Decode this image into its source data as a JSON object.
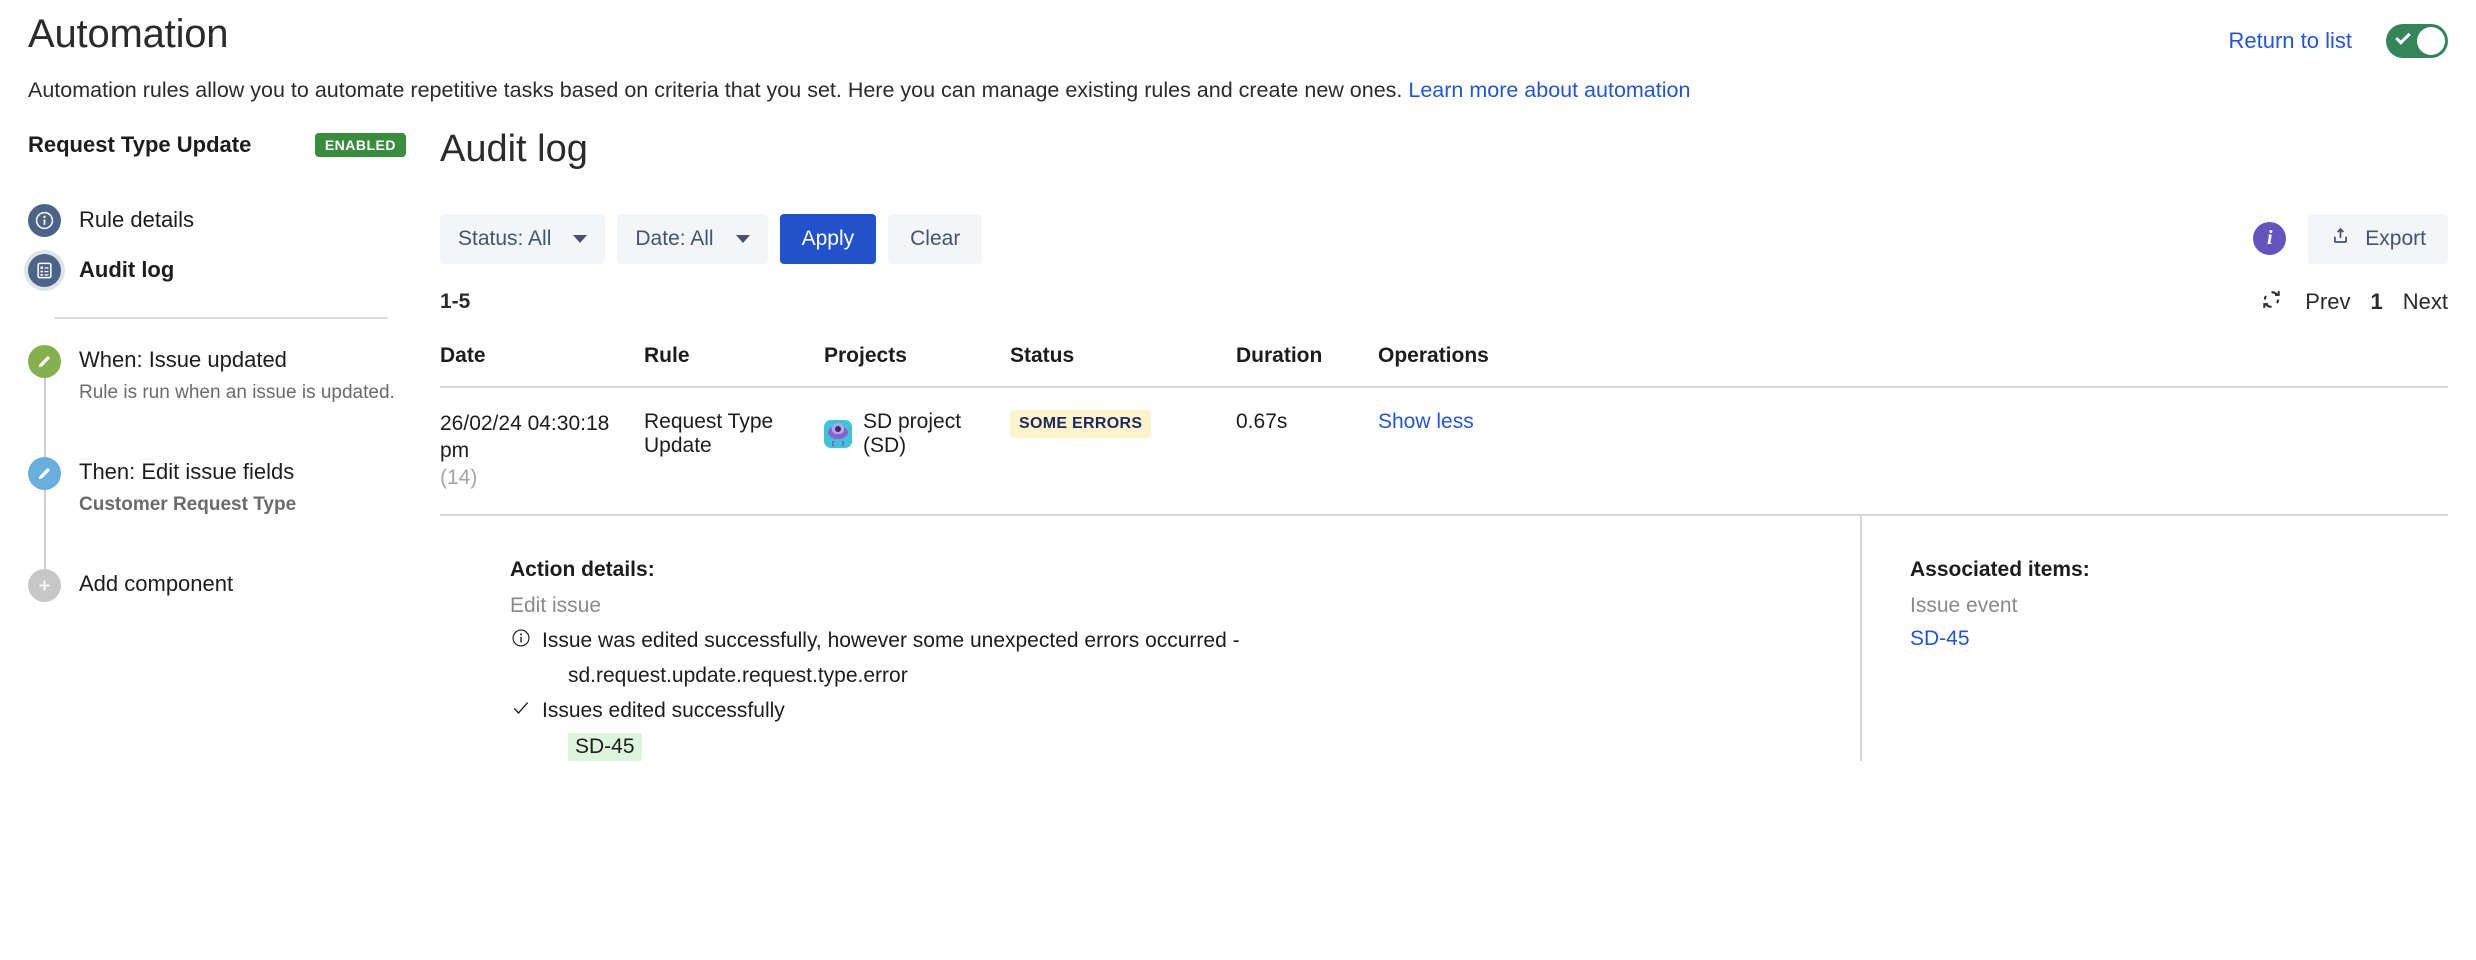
{
  "header": {
    "title": "Automation",
    "return_link": "Return to list",
    "toggle_state": "on",
    "description_prefix": "Automation rules allow you to automate repetitive tasks based on criteria that you set. Here you can manage existing rules and create new ones.",
    "learn_more_link": "Learn more about automation"
  },
  "sidebar": {
    "rule_name": "Request Type Update",
    "rule_status_badge": "ENABLED",
    "nav": [
      {
        "label": "Rule details",
        "icon": "info-circle-icon",
        "active": false
      },
      {
        "label": "Audit log",
        "icon": "logbook-icon",
        "active": true
      }
    ],
    "flow": [
      {
        "title": "When: Issue updated",
        "subtitle": "Rule is run when an issue is updated.",
        "subtitle_bold": false,
        "icon": "pencil-icon",
        "color": "green"
      },
      {
        "title": "Then: Edit issue fields",
        "subtitle": "Customer Request Type",
        "subtitle_bold": true,
        "icon": "pencil-icon",
        "color": "blue"
      },
      {
        "title": "Add component",
        "subtitle": "",
        "subtitle_bold": false,
        "icon": "plus-icon",
        "color": "grey"
      }
    ]
  },
  "main": {
    "title": "Audit log",
    "toolbar": {
      "status_filter": "Status: All",
      "date_filter": "Date: All",
      "apply_label": "Apply",
      "clear_label": "Clear",
      "export_label": "Export"
    },
    "pagination": {
      "range": "1-5",
      "prev_label": "Prev",
      "current_page": "1",
      "next_label": "Next"
    },
    "table": {
      "columns": [
        "Date",
        "Rule",
        "Projects",
        "Status",
        "Duration",
        "Operations"
      ],
      "rows": [
        {
          "date": "26/02/24 04:30:18 pm",
          "date_count": "(14)",
          "rule": "Request Type Update",
          "project": "SD project (SD)",
          "status": "SOME ERRORS",
          "duration": "0.67s",
          "operation": "Show less"
        }
      ]
    },
    "detail": {
      "action_details_heading": "Action details:",
      "action_name": "Edit issue",
      "info_message": "Issue was edited successfully, however some unexpected errors occurred -",
      "info_message_detail": "sd.request.update.request.type.error",
      "success_message": "Issues edited successfully",
      "success_issue_key": "SD-45",
      "associated_items_heading": "Associated items:",
      "associated_type": "Issue event",
      "associated_key": "SD-45"
    }
  },
  "colors": {
    "link_blue": "#2255dd",
    "primary_blue": "#2251cc",
    "enabled_green": "#3a8c3f",
    "toggle_green": "#36845a",
    "warning_badge_bg": "#fdf3cc",
    "info_purple": "#6554c0",
    "success_chip_bg": "#ddf5dd"
  }
}
